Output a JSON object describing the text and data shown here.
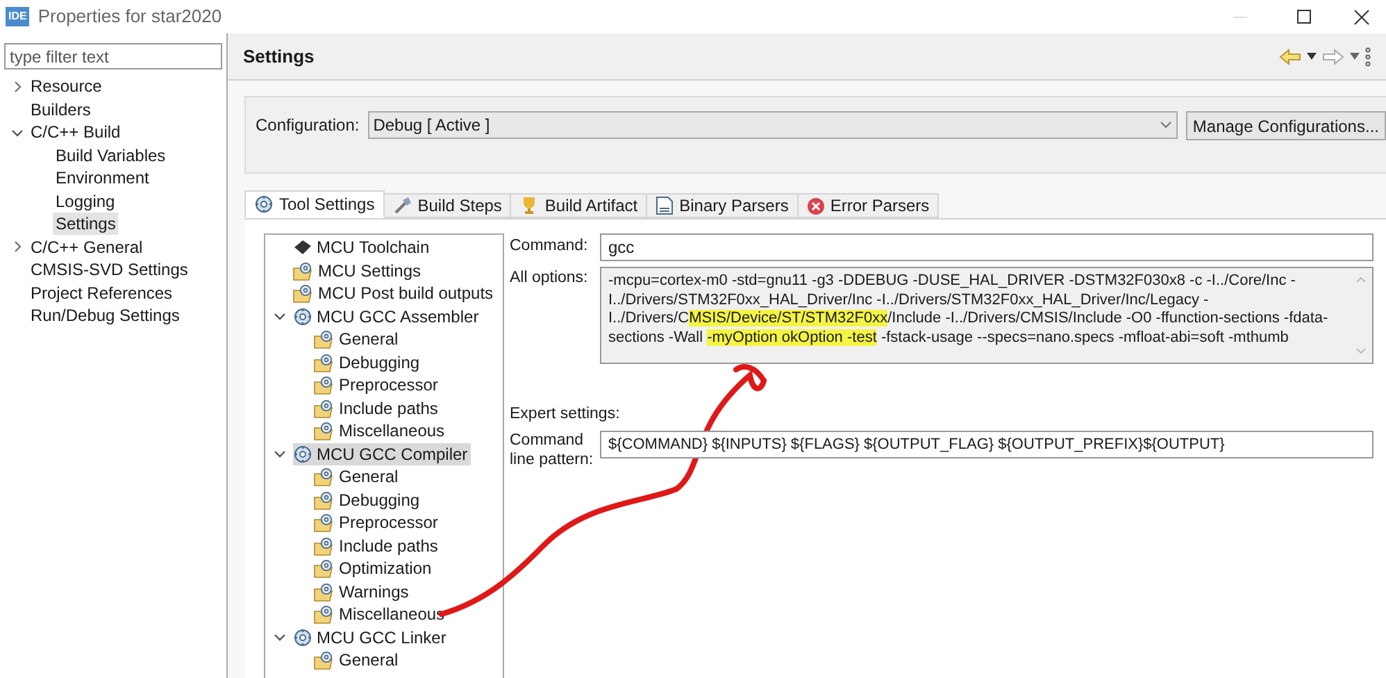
{
  "window": {
    "app_icon": "IDE",
    "title": "Properties for star2020"
  },
  "filter": {
    "placeholder": "type filter text"
  },
  "nav": [
    {
      "label": "Resource",
      "expanded": false,
      "selected": false
    },
    {
      "label": "Builders",
      "selected": false
    },
    {
      "label": "C/C++ Build",
      "expanded": true,
      "selected": false,
      "children": [
        {
          "label": "Build Variables",
          "selected": false
        },
        {
          "label": "Environment",
          "selected": false
        },
        {
          "label": "Logging",
          "selected": false
        },
        {
          "label": "Settings",
          "selected": true
        }
      ]
    },
    {
      "label": "C/C++ General",
      "expanded": false,
      "selected": false
    },
    {
      "label": "CMSIS-SVD Settings",
      "selected": false
    },
    {
      "label": "Project References",
      "selected": false
    },
    {
      "label": "Run/Debug Settings",
      "selected": false
    }
  ],
  "page": {
    "title": "Settings"
  },
  "configuration": {
    "label": "Configuration:",
    "value": "Debug  [ Active ]",
    "button": "Manage Configurations..."
  },
  "tabs": [
    {
      "label": "Tool Settings",
      "selected": true
    },
    {
      "label": "Build Steps",
      "selected": false
    },
    {
      "label": "Build Artifact",
      "selected": false
    },
    {
      "label": "Binary Parsers",
      "selected": false
    },
    {
      "label": "Error Parsers",
      "selected": false
    }
  ],
  "tool_tree": [
    {
      "label": "MCU Toolchain",
      "kind": "toolchain",
      "selected": false
    },
    {
      "label": "MCU Settings",
      "kind": "page",
      "selected": false
    },
    {
      "label": "MCU Post build outputs",
      "kind": "page",
      "selected": false
    },
    {
      "label": "MCU GCC Assembler",
      "kind": "tool",
      "expanded": true,
      "selected": false,
      "children": [
        {
          "label": "General",
          "kind": "page",
          "selected": false
        },
        {
          "label": "Debugging",
          "kind": "page",
          "selected": false
        },
        {
          "label": "Preprocessor",
          "kind": "page",
          "selected": false
        },
        {
          "label": "Include paths",
          "kind": "page",
          "selected": false
        },
        {
          "label": "Miscellaneous",
          "kind": "page",
          "selected": false
        }
      ]
    },
    {
      "label": "MCU GCC Compiler",
      "kind": "tool",
      "expanded": true,
      "selected": true,
      "children": [
        {
          "label": "General",
          "kind": "page",
          "selected": false
        },
        {
          "label": "Debugging",
          "kind": "page",
          "selected": false
        },
        {
          "label": "Preprocessor",
          "kind": "page",
          "selected": false
        },
        {
          "label": "Include paths",
          "kind": "page",
          "selected": false
        },
        {
          "label": "Optimization",
          "kind": "page",
          "selected": false
        },
        {
          "label": "Warnings",
          "kind": "page",
          "selected": false
        },
        {
          "label": "Miscellaneous",
          "kind": "page",
          "selected": false
        }
      ]
    },
    {
      "label": "MCU GCC Linker",
      "kind": "tool",
      "expanded": true,
      "selected": false,
      "children": [
        {
          "label": "General",
          "kind": "page",
          "selected": false
        }
      ]
    }
  ],
  "command": {
    "label": "Command:",
    "value": "gcc"
  },
  "all_options": {
    "label": "All options:",
    "segments": [
      {
        "text": "-mcpu=cortex-m0 -std=gnu11 -g3 -DDEBUG -DUSE_HAL_DRIVER -DSTM32F030x8 -c -I../Core/Inc -I../Drivers/STM32F0xx_HAL_Driver/Inc -I../Drivers/STM32F0xx_HAL_Driver/Inc/Legacy -I../Drivers/C",
        "highlighted": false
      },
      {
        "text": "MSIS/Device/ST/STM32F0xx",
        "highlighted": true
      },
      {
        "text": "/Include -I../Drivers/CMSIS/Include -O0 -ffunction-sections -fdata-sections -Wall ",
        "highlighted": false
      },
      {
        "text": "-myOption okOption -test",
        "highlighted": true
      },
      {
        "text": " -fstack-usage --specs=nano.specs -mfloat-abi=soft -mthumb",
        "highlighted": false
      }
    ]
  },
  "expert": {
    "title": "Expert settings:",
    "pattern_label": "Command line pattern:",
    "pattern_value": "${COMMAND} ${INPUTS} ${FLAGS} ${OUTPUT_FLAG} ${OUTPUT_PREFIX}${OUTPUT}"
  }
}
